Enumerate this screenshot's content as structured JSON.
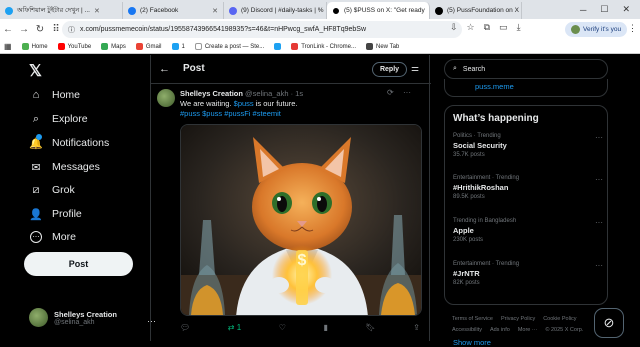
{
  "browser": {
    "tabs": [
      {
        "title": "অফিশিয়াল টুইটার দেখুন | ...",
        "color": "#1da1f2",
        "active": false
      },
      {
        "title": "(2) Facebook",
        "color": "#1877f2",
        "active": false
      },
      {
        "title": "(9) Discord | #daily-tasks | %",
        "color": "#5865f2",
        "active": false
      },
      {
        "title": "(5) $PUSS on X: \"Get ready",
        "color": "#000000",
        "active": true
      },
      {
        "title": "(5) PussFoundation on X",
        "color": "#000000",
        "active": false
      }
    ],
    "url": "x.com/pussmemecoin/status/1955874396654198935?s=46&t=nHPwcg_swfA_HF8Tq9ebSw",
    "verify_label": "Verify it's you",
    "bookmarks": [
      {
        "label": "Home",
        "color": "#4caf50"
      },
      {
        "label": "YouTube",
        "color": "#ff0000"
      },
      {
        "label": "Maps",
        "color": "#34a853"
      },
      {
        "label": "Gmail",
        "color": "#ea4335"
      },
      {
        "label": "1",
        "color": "#1da1f2"
      },
      {
        "label": "Create a post — Ste...",
        "color": "#ffffff"
      },
      {
        "label": "",
        "color": "#1da1f2"
      },
      {
        "label": "TronLink - Chrome...",
        "color": "#e53935"
      },
      {
        "label": "New Tab",
        "color": "#444444"
      }
    ]
  },
  "nav": {
    "logo": "𝕏",
    "items": [
      {
        "label": "Home",
        "icon": "⌂",
        "name": "home"
      },
      {
        "label": "Explore",
        "icon": "⌕",
        "name": "explore"
      },
      {
        "label": "Notifications",
        "icon": "🔔",
        "name": "notifications"
      },
      {
        "label": "Messages",
        "icon": "✉",
        "name": "messages"
      },
      {
        "label": "Grok",
        "icon": "⧄",
        "name": "grok"
      },
      {
        "label": "Profile",
        "icon": "👤",
        "name": "profile"
      },
      {
        "label": "More",
        "icon": "⋯",
        "name": "more"
      }
    ],
    "post_label": "Post",
    "profile": {
      "name": "Shelleys Creation",
      "handle": "@selina_akh"
    }
  },
  "main": {
    "title": "Post",
    "reply_label": "Reply",
    "tweet": {
      "name": "Shelleys Creation",
      "handle_time": "@selina_akh · 1s",
      "text_before": "We are waiting.",
      "text_tag": "$puss",
      "text_after": "is our future.",
      "tags": "#puss $puss #pussFi #steemit",
      "actions": {
        "reply": "",
        "retweets": "1",
        "like": "",
        "views": ""
      }
    }
  },
  "right": {
    "search_placeholder": "Search",
    "top_trend": "puss.meme",
    "happening_title": "What’s happening",
    "trends": [
      {
        "context": "Politics · Trending",
        "name": "Social Security",
        "count": "35.7K posts"
      },
      {
        "context": "Entertainment · Trending",
        "name": "#HrithikRoshan",
        "count": "89.5K posts"
      },
      {
        "context": "Trending in Bangladesh",
        "name": "Apple",
        "count": "230K posts"
      },
      {
        "context": "Entertainment · Trending",
        "name": "#JrNTR",
        "count": "82K posts"
      }
    ],
    "show_more": "Show more",
    "footer": [
      "Terms of Service",
      "Privacy Policy",
      "Cookie Policy",
      "Accessibility",
      "Ads info",
      "More ···",
      "© 2025 X Corp."
    ]
  }
}
